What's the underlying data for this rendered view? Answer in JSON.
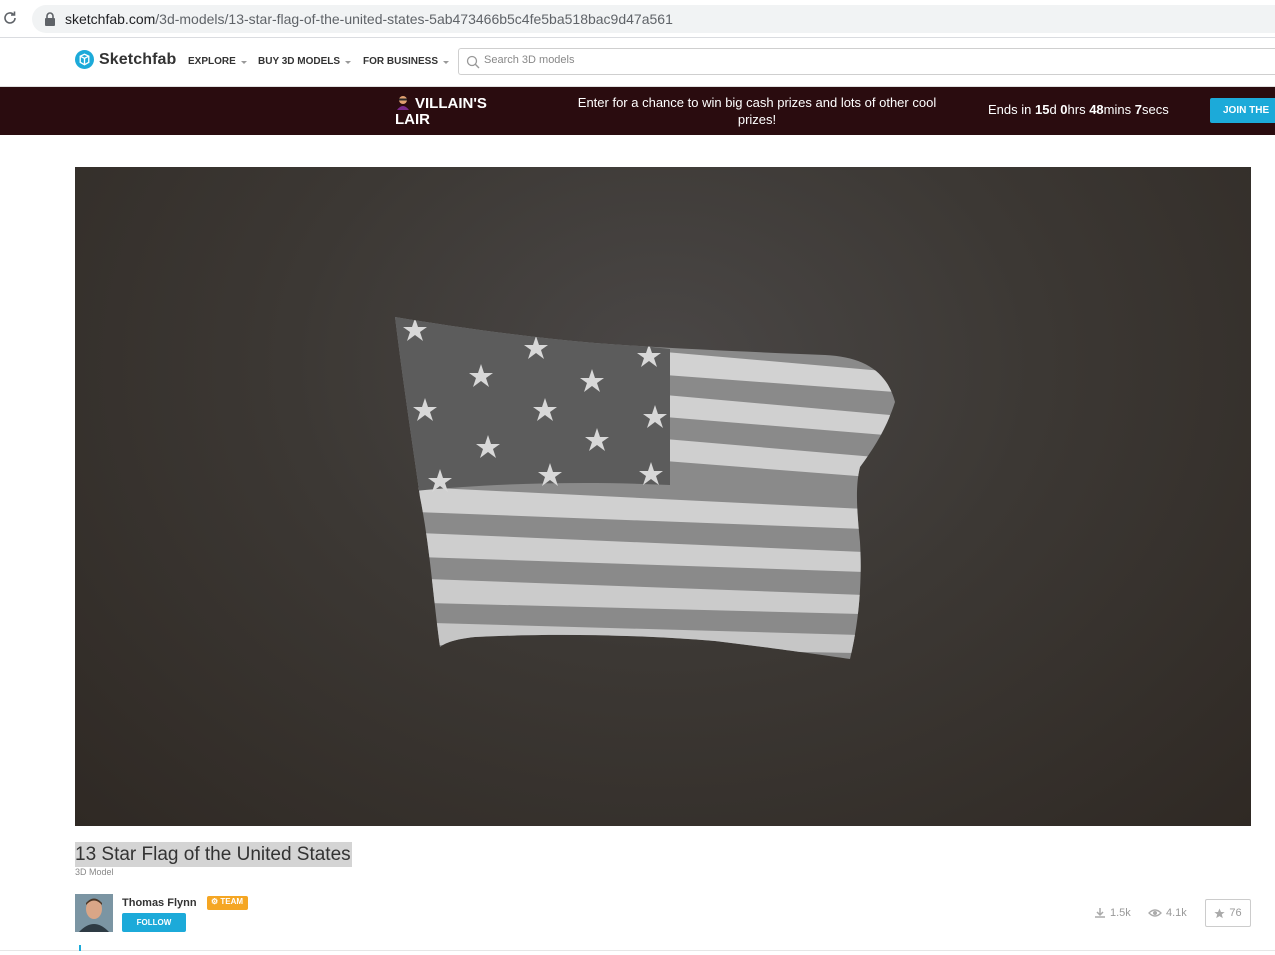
{
  "browser": {
    "url_host": "sketchfab.com",
    "url_path": "/3d-models/13-star-flag-of-the-united-states-5ab473466b5c4fe5ba518bac9d47a561"
  },
  "header": {
    "logo_text": "Sketchfab",
    "nav": [
      {
        "label": "EXPLORE"
      },
      {
        "label": "BUY 3D MODELS"
      },
      {
        "label": "FOR BUSINESS"
      }
    ],
    "search_placeholder": "Search 3D models"
  },
  "promo": {
    "title": "VILLAIN'S LAIR",
    "text": "Enter for a chance to win big cash prizes and lots of other cool prizes!",
    "countdown": {
      "prefix": "Ends in ",
      "days": "15",
      "days_unit": "d ",
      "hours": "0",
      "hours_unit": "hrs ",
      "mins": "48",
      "mins_unit": "mins ",
      "secs": "7",
      "secs_unit": "secs"
    },
    "join_label": "JOIN THE"
  },
  "model": {
    "title": "13 Star Flag of the United States",
    "type": "3D Model"
  },
  "author": {
    "name": "Thomas Flynn",
    "badge": "TEAM",
    "follow_label": "FOLLOW"
  },
  "stats": {
    "downloads": "1.5k",
    "views": "4.1k",
    "likes": "76"
  },
  "colors": {
    "accent": "#1caad9",
    "badge": "#f5a623",
    "banner_bg": "#2a0c0f"
  },
  "icons": [
    "reload-icon",
    "lock-icon",
    "sketchfab-logo-icon",
    "search-icon",
    "villain-icon",
    "download-icon",
    "eye-icon",
    "star-icon"
  ]
}
